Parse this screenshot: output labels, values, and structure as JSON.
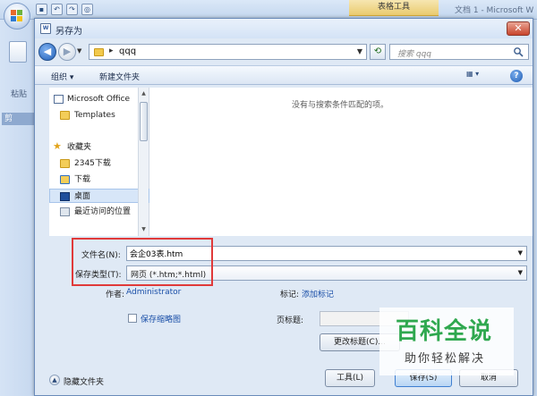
{
  "app": {
    "table_tools": "表格工具",
    "doc_title": "文档 1 - Microsoft W",
    "paste_label": "粘贴",
    "clipboard_label": "剪",
    "qat_icons": [
      "save-icon",
      "undo-icon",
      "redo-icon",
      "print-preview-icon"
    ]
  },
  "dialog": {
    "title": "另存为",
    "close_glyph": "✕",
    "nav": {
      "back_glyph": "◀",
      "forward_glyph": "▶",
      "path_sep": "▸",
      "path": "qqq",
      "search_placeholder": "搜索 qqq",
      "refresh_glyph": "⟲"
    },
    "toolbar": {
      "organize": "组织 ▾",
      "new_folder": "新建文件夹",
      "view_glyph": "▦ ▾",
      "help_glyph": "?"
    },
    "nav_pane": {
      "items": [
        {
          "label": "Microsoft Office",
          "icon": "word-icon"
        },
        {
          "label": "Templates",
          "icon": "folder-icon"
        },
        {
          "label": "收藏夹",
          "icon": "star-icon"
        },
        {
          "label": "2345下载",
          "icon": "folder-icon"
        },
        {
          "label": "下载",
          "icon": "download-folder-icon"
        },
        {
          "label": "桌面",
          "icon": "desktop-icon"
        },
        {
          "label": "最近访问的位置",
          "icon": "recent-places-icon"
        }
      ]
    },
    "empty_message": "没有与搜索条件匹配的项。",
    "form": {
      "filename_label": "文件名(N):",
      "filename_value": "会企03表.htm",
      "filetype_label": "保存类型(T):",
      "filetype_value": "网页 (*.htm;*.html)",
      "author_label": "作者:",
      "author_value": "Administrator",
      "tags_label": "标记:",
      "tags_value": "添加标记",
      "thumbnail_label": "保存缩略图",
      "page_title_label": "页标题:",
      "change_title_button": "更改标题(C)...",
      "tools_button": "工具(L)",
      "save_button": "保存(S)",
      "cancel_button": "取消",
      "hide_folders": "隐藏文件夹"
    }
  },
  "watermark": {
    "main": "百科全说",
    "sub": "助你轻松解决"
  },
  "colors": {
    "highlight_border": "#e03a3a",
    "watermark_green": "#2fa84f",
    "link_blue": "#1a4fa8"
  }
}
